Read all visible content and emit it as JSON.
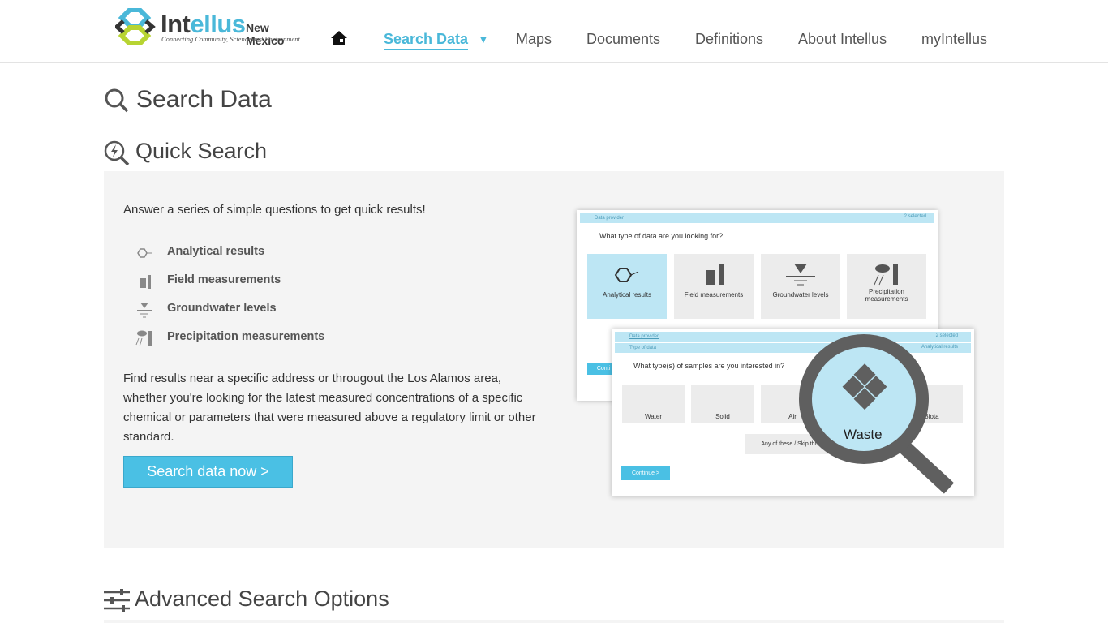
{
  "header": {
    "logo": {
      "name_a": "Int",
      "name_b": "ellus",
      "region": "New Mexico",
      "tagline": "Connecting Community, Science and Environment"
    },
    "nav": [
      {
        "label": "Search Data",
        "active": true
      },
      {
        "label": "Maps"
      },
      {
        "label": "Documents"
      },
      {
        "label": "Definitions"
      },
      {
        "label": "About Intellus"
      },
      {
        "label": "myIntellus"
      }
    ]
  },
  "page_title": "Search Data",
  "quick_search": {
    "title": "Quick Search",
    "intro": "Answer a series of simple questions to get quick results!",
    "features": [
      "Analytical results",
      "Field measurements",
      "Groundwater levels",
      "Precipitation measurements"
    ],
    "description": "Find results near a specific address or througout the Los Alamos area, whether you're looking for the latest measured concentrations of a specific chemical or parameters that were measured above a regulatory limit or other standard.",
    "button": "Search data now >",
    "illustration": {
      "card1": {
        "bar": "Data provider",
        "bar_right": "2 selected",
        "question": "What type of data are you looking for?",
        "tiles": [
          "Analytical results",
          "Field measurements",
          "Groundwater levels",
          "Precipitation measurements"
        ],
        "continue": "Conti"
      },
      "card2": {
        "bar1": "Data provider",
        "bar1_right": "2 selected",
        "bar2": "Type of data",
        "bar2_right": "Analytical results",
        "question": "What type(s) of samples are you interested in?",
        "tiles": [
          "Water",
          "Solid",
          "Air",
          "Biota"
        ],
        "skip": "Any of these / Skip this",
        "continue": "Continue >",
        "magnified": "Waste"
      }
    }
  },
  "advanced_title": "Advanced Search Options",
  "colors": {
    "accent": "#4ab8d9",
    "panel": "#f4f4f4"
  }
}
